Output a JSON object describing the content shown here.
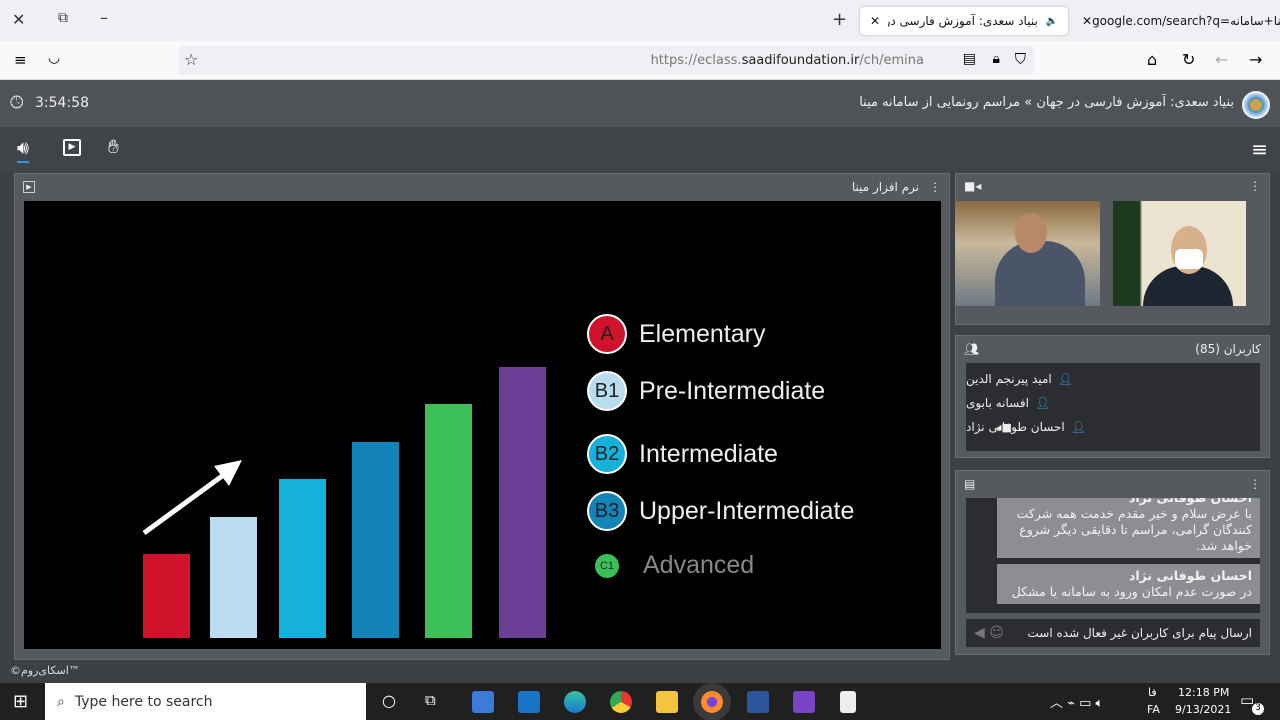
{
  "browser": {
    "tabs": [
      {
        "label": "بنیاد سعدی: آموزش فارسی در جها",
        "active": true
      },
      {
        "label": "google.com/search?q=مینا+سامانه",
        "active": false
      }
    ],
    "url_prefix": "https://eclass.",
    "url_domain": "saadifoundation.ir",
    "url_path": "/ch/emina"
  },
  "app": {
    "timer": "3:54:58",
    "title": "بنیاد سعدی: آموزش فارسی در جهان » مراسم رونمایی از سامانه مینا",
    "footer": "©اسکای‌روم™"
  },
  "presentation": {
    "title": "نرم افزار مینا",
    "chart_data": {
      "type": "bar",
      "values": [
        1,
        2,
        3,
        4,
        5,
        6
      ],
      "colors": [
        "#d0122b",
        "#b9dcee",
        "#14b1da",
        "#1384b8",
        "#3dbf57",
        "#6c3f96"
      ],
      "legend": [
        {
          "badge": "A",
          "label": "Elementary",
          "color": "#d0122b"
        },
        {
          "badge": "B1",
          "label": "Pre-Intermediate",
          "color": "#b9dcee"
        },
        {
          "badge": "B2",
          "label": "Intermediate",
          "color": "#14b1da"
        },
        {
          "badge": "B3",
          "label": "Upper-Intermediate",
          "color": "#1384b8"
        },
        {
          "badge": "C1",
          "label": "Advanced",
          "color": "#3dbf57"
        }
      ]
    }
  },
  "users": {
    "title": "کاربران (85)",
    "list": [
      "امید پیرنجم الدین",
      "افسانه بابوی",
      "احسان طوفانی نژاد"
    ]
  },
  "chat": {
    "messages": [
      {
        "author": "احسان طوفانی نژاد",
        "text": "با عرض سلام و خیر مقدم خدمت همه شرکت کنندگان گرامی، مراسم تا دقایقی دیگر شروع خواهد شد."
      },
      {
        "author": "احسان طوفانی نژاد",
        "text": "در صورت عدم امکان ورود به سامانه یا مشکل"
      }
    ],
    "input_placeholder": "ارسال پیام برای کاربران غیر فعال شده است"
  },
  "taskbar": {
    "search_placeholder": "Type here to search",
    "lang": "FA",
    "lang2": "فا",
    "time": "12:18 PM",
    "date": "9/13/2021",
    "notifications": "3"
  }
}
